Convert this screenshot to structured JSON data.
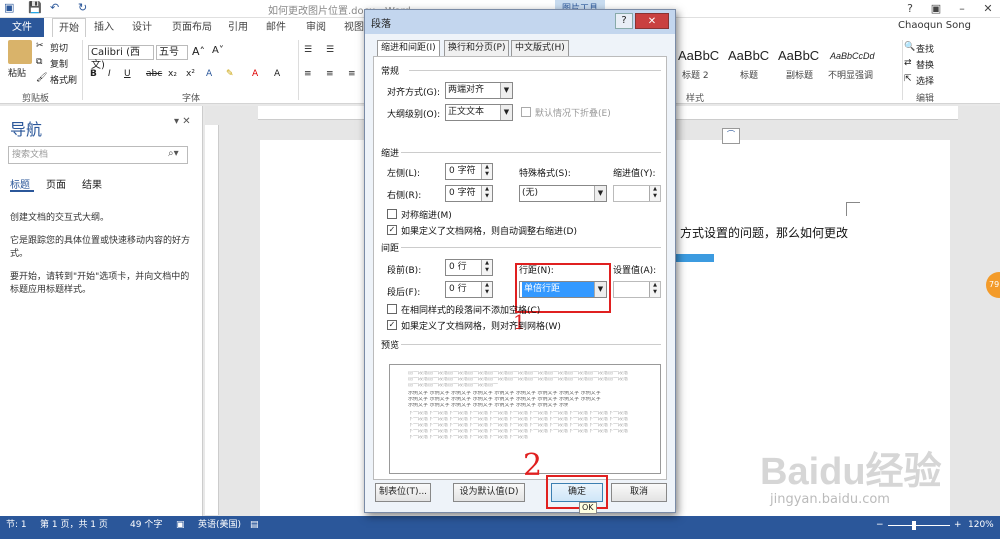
{
  "window": {
    "title": "如何更改图片位置.docx - Word",
    "picture_tools": "图片工具",
    "user": "Chaoqun Song"
  },
  "tabs": [
    "文件",
    "开始",
    "插入",
    "设计",
    "页面布局",
    "引用",
    "邮件",
    "审阅",
    "视图"
  ],
  "ribbon": {
    "clipboard": {
      "paste": "粘贴",
      "cut": "剪切",
      "copy": "复制",
      "format_painter": "格式刷",
      "group": "剪贴板"
    },
    "font": {
      "name": "Calibri (西文)",
      "size": "五号",
      "group": "字体"
    },
    "styles": {
      "tiles": [
        {
          "sample": "AaBbC",
          "label": "标题 2"
        },
        {
          "sample": "AaBbC",
          "label": "标题"
        },
        {
          "sample": "AaBbC",
          "label": "副标题"
        },
        {
          "sample": "AaBbCcDd",
          "label": "不明显强调"
        }
      ],
      "group": "样式"
    },
    "editing": {
      "find": "查找",
      "replace": "替换",
      "select": "选择",
      "group": "编辑"
    }
  },
  "nav": {
    "title": "导航",
    "search_placeholder": "搜索文档",
    "tabs": [
      "标题",
      "页面",
      "结果"
    ],
    "para1": "创建文档的交互式大纲。",
    "para2": "它是跟踪您的具体位置或快速移动内容的好方式。",
    "para3": "要开始，请转到\"开始\"选项卡，并向文档中的标题应用标题样式。"
  },
  "document": {
    "text_fragment": "方式设置的问题，那么如何更改"
  },
  "status": {
    "section": "节: 1",
    "page": "第 1 页，共 1 页",
    "words": "49 个字",
    "language": "英语(美国)",
    "zoom": "120%"
  },
  "dialog": {
    "title": "段落",
    "tabs": [
      "缩进和间距(I)",
      "换行和分页(P)",
      "中文版式(H)"
    ],
    "general": {
      "section": "常规",
      "alignment_label": "对齐方式(G):",
      "alignment_value": "两端对齐",
      "outline_label": "大纲级别(O):",
      "outline_value": "正文文本",
      "collapse_label": "默认情况下折叠(E)"
    },
    "indent": {
      "section": "缩进",
      "left_label": "左侧(L):",
      "left_value": "0 字符",
      "right_label": "右侧(R):",
      "right_value": "0 字符",
      "special_label": "特殊格式(S):",
      "special_value": "(无)",
      "by_label": "缩进值(Y):",
      "mirror_label": "对称缩进(M)",
      "auto_adjust_label": "如果定义了文档网格，则自动调整右缩进(D)"
    },
    "spacing": {
      "section": "间距",
      "before_label": "段前(B):",
      "before_value": "0 行",
      "after_label": "段后(F):",
      "after_value": "0 行",
      "line_label": "行距(N):",
      "line_value": "单倍行距",
      "at_label": "设置值(A):",
      "no_space_label": "在相同样式的段落间不添加空格(C)",
      "snap_grid_label": "如果定义了文档网格，则对齐到网格(W)"
    },
    "preview": {
      "section": "预览",
      "prev_line": "前一段落前一段落前一段落前一段落前一段落前一段落前一段落前一段落前一段落前一段落前一段落",
      "sample_line": "示例文字 示例文字 示例文字 示例文字 示例文字 示例文字 示例文字 示例文字 示例文字",
      "next_line": "下一段落下一段落下一段落下一段落下一段落下一段落下一段落下一段落下一段落下一段落下一段落"
    },
    "buttons": {
      "tabs": "制表位(T)...",
      "default": "设为默认值(D)",
      "ok": "确定",
      "cancel": "取消",
      "ok_tooltip": "OK"
    },
    "annotations": {
      "step1": "1",
      "step2": "2"
    }
  },
  "watermark": {
    "brand": "Baidu经验",
    "url": "jingyan.baidu.com"
  },
  "colors": {
    "accent": "#2b579a",
    "highlight": "#e02020"
  }
}
